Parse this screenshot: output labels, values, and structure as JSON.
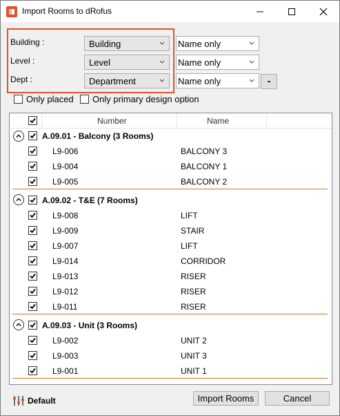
{
  "window": {
    "title": "Import Rooms to dRofus"
  },
  "filters": [
    {
      "label": "Building :",
      "value": "Building",
      "mode": "Name only"
    },
    {
      "label": "Level :",
      "value": "Level",
      "mode": "Name only"
    },
    {
      "label": "Dept :",
      "value": "Department",
      "mode": "Name only",
      "extra_button": "-"
    }
  ],
  "options": {
    "only_placed": {
      "label": "Only placed",
      "checked": false
    },
    "only_primary": {
      "label": "Only primary design option",
      "checked": false
    }
  },
  "columns": {
    "number": "Number",
    "name": "Name"
  },
  "groups": [
    {
      "title": "A.09.01 - Balcony (3 Rooms)",
      "rows": [
        {
          "number": "L9-006",
          "name": "BALCONY 3"
        },
        {
          "number": "L9-004",
          "name": "BALCONY 1"
        },
        {
          "number": "L9-005",
          "name": "BALCONY 2"
        }
      ]
    },
    {
      "title": "A.09.02 - T&E (7 Rooms)",
      "rows": [
        {
          "number": "L9-008",
          "name": "LIFT"
        },
        {
          "number": "L9-009",
          "name": "STAIR"
        },
        {
          "number": "L9-007",
          "name": "LIFT"
        },
        {
          "number": "L9-014",
          "name": "CORRIDOR"
        },
        {
          "number": "L9-013",
          "name": "RISER"
        },
        {
          "number": "L9-012",
          "name": "RISER"
        },
        {
          "number": "L9-011",
          "name": "RISER"
        }
      ]
    },
    {
      "title": "A.09.03 - Unit (3 Rooms)",
      "rows": [
        {
          "number": "L9-002",
          "name": "UNIT 2"
        },
        {
          "number": "L9-003",
          "name": "UNIT 3"
        },
        {
          "number": "L9-001",
          "name": "UNIT 1"
        }
      ]
    }
  ],
  "footer": {
    "profile_label": "Default",
    "import_button": "Import Rooms",
    "cancel_button": "Cancel"
  },
  "colors": {
    "highlight": "#e0522a",
    "group_separator": "#c8761f"
  }
}
